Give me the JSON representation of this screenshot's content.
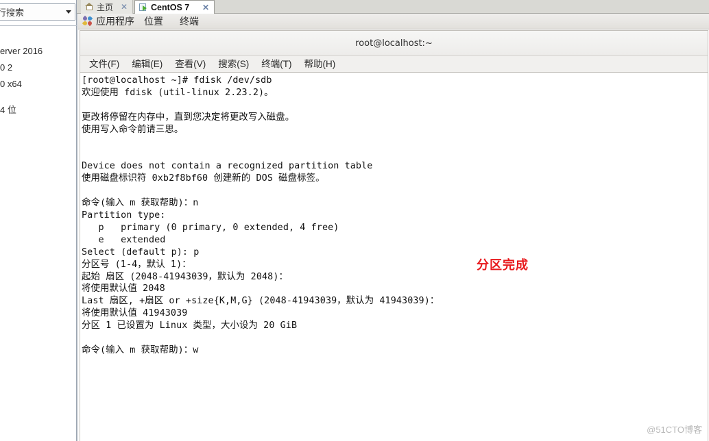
{
  "sidebar": {
    "search": {
      "value": "行搜索",
      "placeholder": "行搜索"
    },
    "items": [
      {
        "label": "erver 2016"
      },
      {
        "label": "0 2"
      },
      {
        "label": "0 x64"
      },
      {
        "label": "4 位"
      }
    ]
  },
  "tabs": [
    {
      "label": "主页",
      "icon": "home-icon",
      "close": "✕",
      "active": false
    },
    {
      "label": "CentOS 7",
      "icon": "virtual-machine-icon",
      "close": "✕",
      "active": true
    }
  ],
  "gnome_panel": {
    "menu_icon": "gnome-foot-icon",
    "items": [
      {
        "label": "应用程序"
      },
      {
        "label": "位置"
      },
      {
        "label": "终端"
      }
    ]
  },
  "terminal": {
    "title": "root@localhost:~",
    "menus": [
      {
        "label": "文件(F)"
      },
      {
        "label": "编辑(E)"
      },
      {
        "label": "查看(V)"
      },
      {
        "label": "搜索(S)"
      },
      {
        "label": "终端(T)"
      },
      {
        "label": "帮助(H)"
      }
    ],
    "content": "[root@localhost ~]# fdisk /dev/sdb\n欢迎使用 fdisk (util-linux 2.23.2)。\n\n更改将停留在内存中，直到您决定将更改写入磁盘。\n使用写入命令前请三思。\n\n\nDevice does not contain a recognized partition table\n使用磁盘标识符 0xb2f8bf60 创建新的 DOS 磁盘标签。\n\n命令(输入 m 获取帮助)：n\nPartition type:\n   p   primary (0 primary, 0 extended, 4 free)\n   e   extended\nSelect (default p): p\n分区号 (1-4，默认 1)：\n起始 扇区 (2048-41943039，默认为 2048)：\n将使用默认值 2048\nLast 扇区, +扇区 or +size{K,M,G} (2048-41943039，默认为 41943039)：\n将使用默认值 41943039\n分区 1 已设置为 Linux 类型，大小设为 20 GiB\n\n命令(输入 m 获取帮助)：w"
  },
  "annotation": {
    "text": "分区完成",
    "color": "#e8191c"
  },
  "watermark": {
    "text": "@51CTO博客"
  }
}
